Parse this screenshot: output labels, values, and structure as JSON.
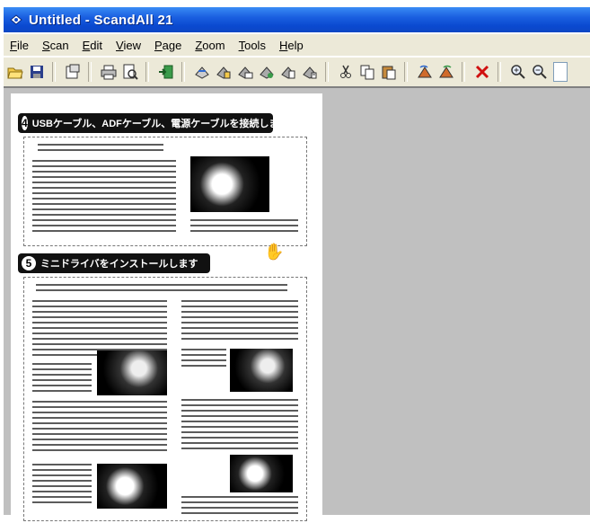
{
  "window": {
    "title": "Untitled - ScandAll 21"
  },
  "menu": [
    "File",
    "Scan",
    "Edit",
    "View",
    "Page",
    "Zoom",
    "Tools",
    "Help"
  ],
  "toolbar": {
    "buttons": [
      "open-icon",
      "save-icon",
      "properties-icon",
      "print-icon",
      "print-preview-icon",
      "exit-icon",
      "scan-icon",
      "scan-to-file-icon",
      "scan-to-mail-icon",
      "scan-to-print-icon",
      "scan-to-page-icon",
      "batch-scan-icon",
      "cut-icon",
      "copy-icon",
      "paste-icon",
      "rotate-left-icon",
      "rotate-right-icon",
      "delete-icon",
      "zoom-in-icon",
      "zoom-out-icon"
    ]
  },
  "document": {
    "step4": {
      "number": "4",
      "heading": "USBケーブル、ADFケーブル、電源ケーブルを接続します"
    },
    "step5": {
      "number": "5",
      "heading": "ミニドライバをインストールします"
    }
  }
}
